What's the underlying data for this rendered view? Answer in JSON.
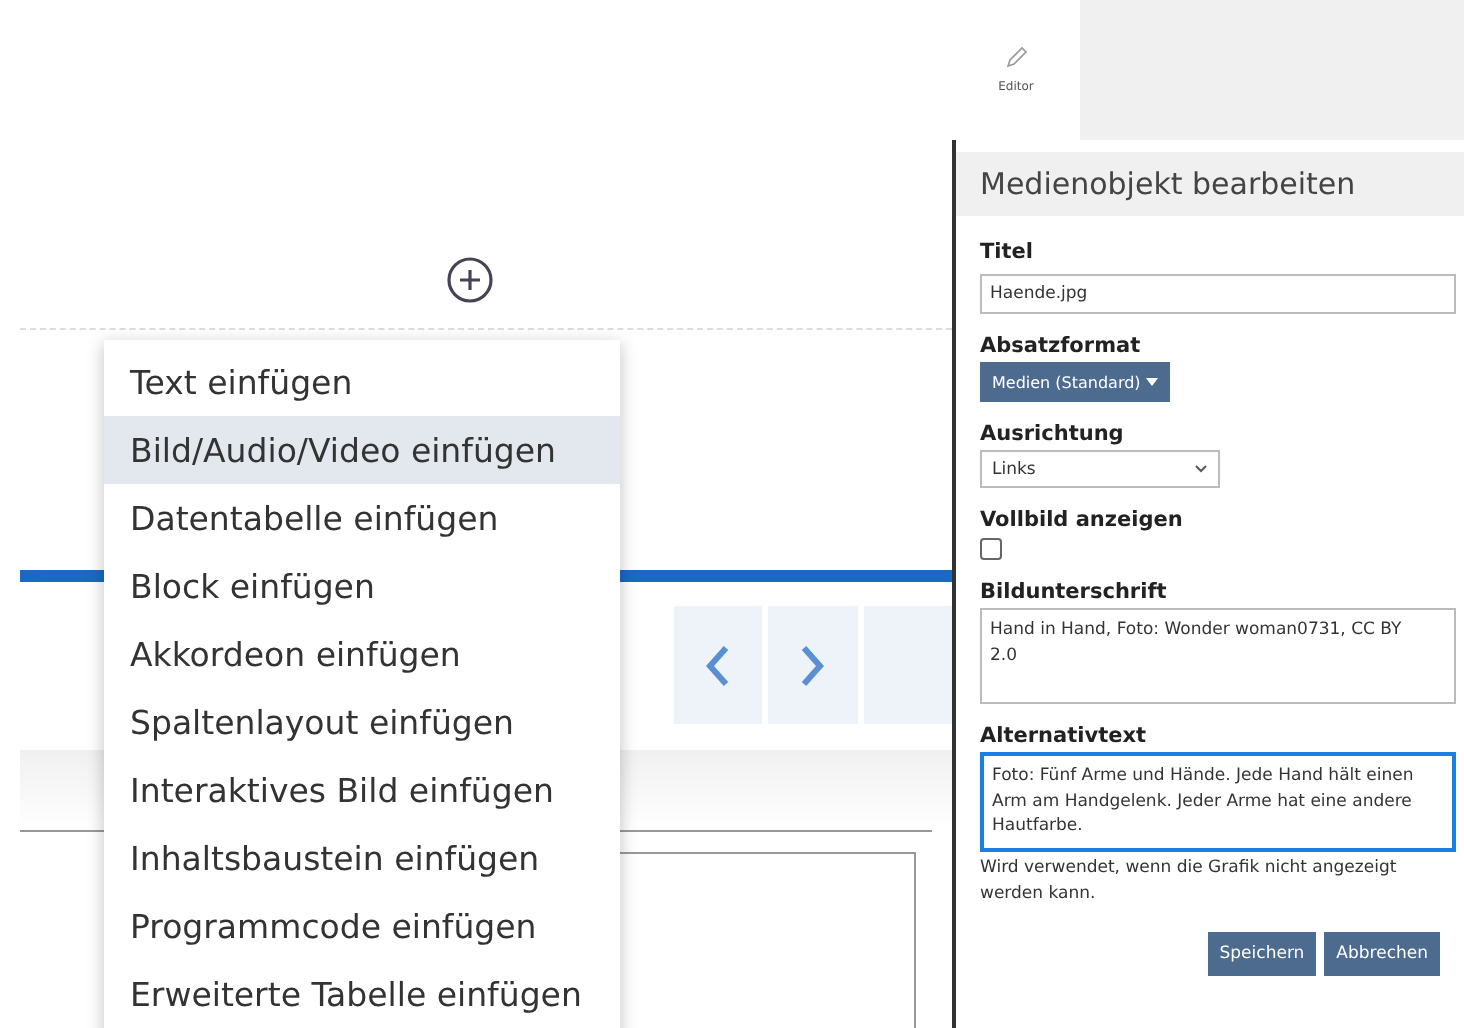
{
  "insert_menu": {
    "items": [
      {
        "label": "Text einfügen",
        "selected": false
      },
      {
        "label": "Bild/Audio/Video einfügen",
        "selected": true
      },
      {
        "label": "Datentabelle einfügen",
        "selected": false
      },
      {
        "label": "Block einfügen",
        "selected": false
      },
      {
        "label": "Akkordeon einfügen",
        "selected": false
      },
      {
        "label": "Spaltenlayout einfügen",
        "selected": false
      },
      {
        "label": "Interaktives Bild einfügen",
        "selected": false
      },
      {
        "label": "Inhaltsbaustein einfügen",
        "selected": false
      },
      {
        "label": "Programmcode einfügen",
        "selected": false
      },
      {
        "label": "Erweiterte Tabelle einfügen",
        "selected": false
      }
    ]
  },
  "side_tabs": [
    {
      "label": "Editor",
      "selected": true
    }
  ],
  "panel": {
    "title": "Medienobjekt bearbeiten",
    "fields": [
      {
        "kind": "text",
        "label": "Titel",
        "value": "Haende.jpg"
      },
      {
        "kind": "dropdown_button",
        "label": "Absatzformat",
        "value": "Medien (Standard)"
      },
      {
        "kind": "select",
        "label": "Ausrichtung",
        "value": "Links"
      },
      {
        "kind": "checkbox",
        "label": "Vollbild anzeigen",
        "checked": false
      },
      {
        "kind": "textarea",
        "label": "Bildunterschrift",
        "value": "Hand in Hand, Foto: Wonder woman0731, CC BY 2.0",
        "focused": false
      },
      {
        "kind": "textarea",
        "label": "Alternativtext",
        "value": "Foto: Fünf Arme und Hände. Jede Hand hält einen Arm am Handgelenk. Jeder Arme hat eine andere Hautfarbe.",
        "focused": true,
        "help": "Wird verwendet, wenn die Grafik nicht angezeigt werden kann."
      }
    ],
    "buttons": [
      "Speichern",
      "Abbrechen"
    ]
  }
}
